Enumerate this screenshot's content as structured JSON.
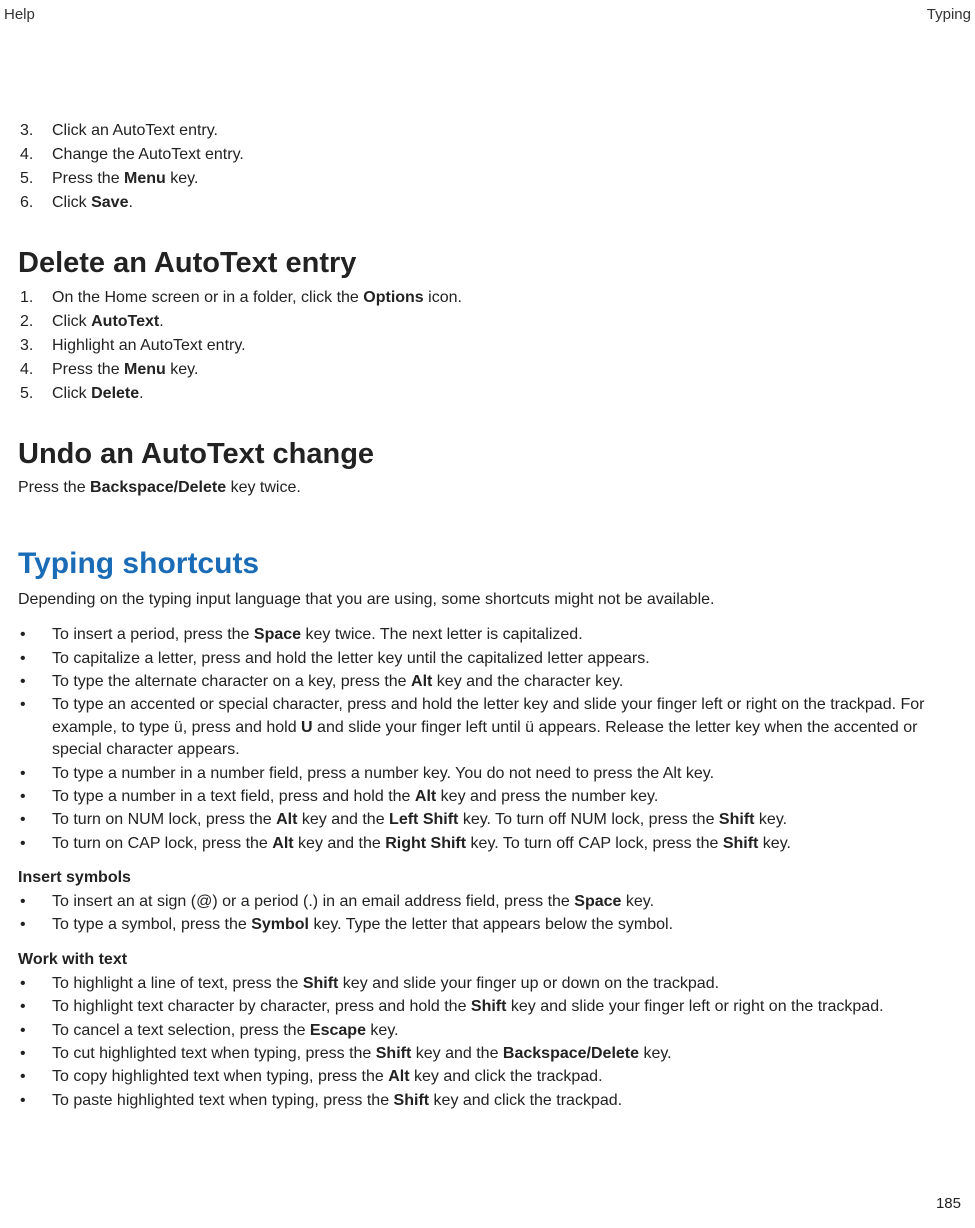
{
  "header": {
    "left": "Help",
    "right": "Typing"
  },
  "page_number": "185",
  "initial_steps": [
    {
      "n": "3.",
      "segs": [
        "Click an AutoText entry."
      ]
    },
    {
      "n": "4.",
      "segs": [
        "Change the AutoText entry."
      ]
    },
    {
      "n": "5.",
      "segs": [
        "Press the ",
        {
          "b": "Menu"
        },
        " key."
      ]
    },
    {
      "n": "6.",
      "segs": [
        "Click ",
        {
          "b": "Save"
        },
        "."
      ]
    }
  ],
  "sec_delete": {
    "title": "Delete an AutoText entry",
    "steps": [
      {
        "n": "1.",
        "segs": [
          "On the Home screen or in a folder, click the ",
          {
            "b": "Options"
          },
          " icon."
        ]
      },
      {
        "n": "2.",
        "segs": [
          "Click ",
          {
            "b": "AutoText"
          },
          "."
        ]
      },
      {
        "n": "3.",
        "segs": [
          "Highlight an AutoText entry."
        ]
      },
      {
        "n": "4.",
        "segs": [
          "Press the ",
          {
            "b": "Menu"
          },
          " key."
        ]
      },
      {
        "n": "5.",
        "segs": [
          "Click ",
          {
            "b": "Delete"
          },
          "."
        ]
      }
    ]
  },
  "sec_undo": {
    "title": "Undo an AutoText change",
    "body": [
      "Press the ",
      {
        "b": "Backspace/Delete"
      },
      " key twice."
    ]
  },
  "sec_shortcuts": {
    "title": "Typing shortcuts",
    "intro": "Depending on the typing input language that you are using, some shortcuts might not be available.",
    "bullets": [
      [
        "To insert a period, press the ",
        {
          "b": "Space"
        },
        " key twice. The next letter is capitalized."
      ],
      [
        "To capitalize a letter, press and hold the letter key until the capitalized letter appears."
      ],
      [
        "To type the alternate character on a key, press the ",
        {
          "b": "Alt"
        },
        " key and the character key."
      ],
      [
        "To type an accented or special character, press and hold the letter key and slide your finger left or right on the trackpad. For example, to type ü, press and hold ",
        {
          "b": "U"
        },
        " and slide your finger left until ü appears. Release the letter key when the accented or special character appears."
      ],
      [
        "To type a number in a number field, press a number key. You do not need to press the Alt key."
      ],
      [
        "To type a number in a text field, press and hold the ",
        {
          "b": "Alt"
        },
        " key and press the number key."
      ],
      [
        "To turn on NUM lock, press the ",
        {
          "b": "Alt"
        },
        " key and the ",
        {
          "b": "Left Shift"
        },
        " key. To turn off NUM lock, press the ",
        {
          "b": "Shift"
        },
        " key."
      ],
      [
        "To turn on CAP lock, press the ",
        {
          "b": "Alt"
        },
        " key and the ",
        {
          "b": "Right Shift"
        },
        " key. To turn off CAP lock, press the ",
        {
          "b": "Shift"
        },
        " key."
      ]
    ],
    "insert_head": "Insert symbols",
    "insert_bullets": [
      [
        "To insert an at sign (@) or a period (.) in an email address field, press the ",
        {
          "b": "Space"
        },
        " key."
      ],
      [
        "To type a symbol, press the ",
        {
          "b": "Symbol"
        },
        " key. Type the letter that appears below the symbol."
      ]
    ],
    "work_head": "Work with text",
    "work_bullets": [
      [
        "To highlight a line of text, press the ",
        {
          "b": "Shift"
        },
        " key and slide your finger up or down on the trackpad."
      ],
      [
        "To highlight text character by character, press and hold the ",
        {
          "b": "Shift"
        },
        " key and slide your finger left or right on the trackpad."
      ],
      [
        "To cancel a text selection, press the ",
        {
          "b": "Escape"
        },
        " key."
      ],
      [
        "To cut highlighted text when typing, press the ",
        {
          "b": "Shift"
        },
        " key and the ",
        {
          "b": "Backspace/Delete"
        },
        " key."
      ],
      [
        "To copy highlighted text when typing, press the ",
        {
          "b": "Alt"
        },
        " key and click the trackpad."
      ],
      [
        "To paste highlighted text when typing, press the ",
        {
          "b": "Shift"
        },
        " key and click the trackpad."
      ]
    ]
  }
}
